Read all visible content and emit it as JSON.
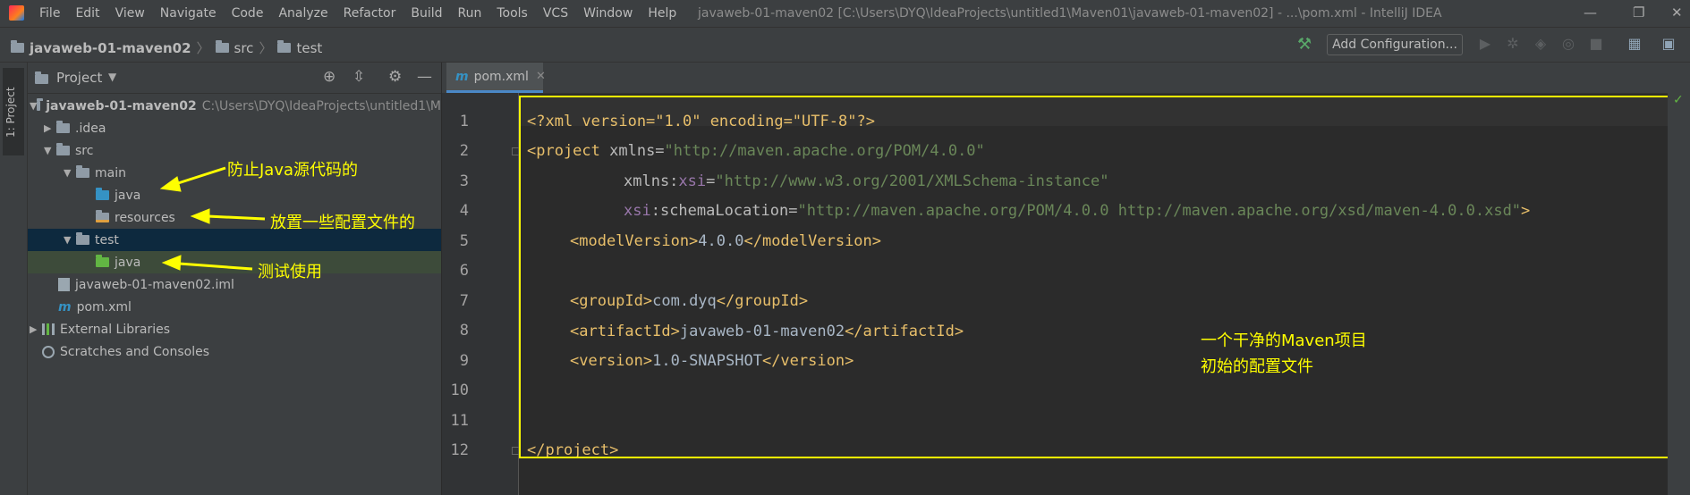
{
  "menu": [
    "File",
    "Edit",
    "View",
    "Navigate",
    "Code",
    "Analyze",
    "Refactor",
    "Build",
    "Run",
    "Tools",
    "VCS",
    "Window",
    "Help"
  ],
  "window_title": "javaweb-01-maven02 [C:\\Users\\DYQ\\IdeaProjects\\untitled1\\Maven01\\javaweb-01-maven02] - ...\\pom.xml - IntelliJ IDEA",
  "window_controls": {
    "minimize": "—",
    "restore": "❐",
    "close": "✕"
  },
  "breadcrumb": [
    "javaweb-01-maven02",
    "src",
    "test"
  ],
  "toolbar": {
    "add_configuration": "Add Configuration..."
  },
  "side_tab": "1: Project",
  "project_panel": {
    "title": "Project",
    "tree": [
      {
        "label": "javaweb-01-maven02",
        "hint": "C:\\Users\\DYQ\\IdeaProjects\\untitled1\\M"
      },
      {
        "label": ".idea"
      },
      {
        "label": "src"
      },
      {
        "label": "main"
      },
      {
        "label": "java"
      },
      {
        "label": "resources"
      },
      {
        "label": "test"
      },
      {
        "label": "java"
      },
      {
        "label": "javaweb-01-maven02.iml"
      },
      {
        "label": "pom.xml"
      },
      {
        "label": "External Libraries"
      },
      {
        "label": "Scratches and Consoles"
      }
    ]
  },
  "annotations": {
    "main_note": "防止Java源代码的",
    "resources_note": "放置一些配置文件的",
    "test_note": "测试使用",
    "editor_note_1": "一个干净的Maven项目",
    "editor_note_2": "初始的配置文件"
  },
  "editor": {
    "tab": "pom.xml",
    "line_numbers": [
      "1",
      "2",
      "3",
      "4",
      "5",
      "6",
      "7",
      "8",
      "9",
      "10",
      "11",
      "12"
    ],
    "code": {
      "l1_open": "<?xml version=\"1.0\" encoding=\"UTF-8\"?>",
      "l2_tag": "<project",
      "l2_attr": " xmlns=",
      "l2_val": "\"http://maven.apache.org/POM/4.0.0\"",
      "l3_attr": "xmlns:",
      "l3_ns": "xsi",
      "l3_eq": "=",
      "l3_val": "\"http://www.w3.org/2001/XMLSchema-instance\"",
      "l4_ns": "xsi",
      "l4_attr": ":schemaLocation=",
      "l4_val": "\"http://maven.apache.org/POM/4.0.0 http://maven.apache.org/xsd/maven-4.0.0.xsd\"",
      "l4_end": ">",
      "l5_open": "<modelVersion>",
      "l5_text": "4.0.0",
      "l5_close": "</modelVersion>",
      "l7_open": "<groupId>",
      "l7_text": "com.dyq",
      "l7_close": "</groupId>",
      "l8_open": "<artifactId>",
      "l8_text": "javaweb-01-maven02",
      "l8_close": "</artifactId>",
      "l9_open": "<version>",
      "l9_text": "1.0-SNAPSHOT",
      "l9_close": "</version>",
      "l12": "</project>"
    }
  }
}
